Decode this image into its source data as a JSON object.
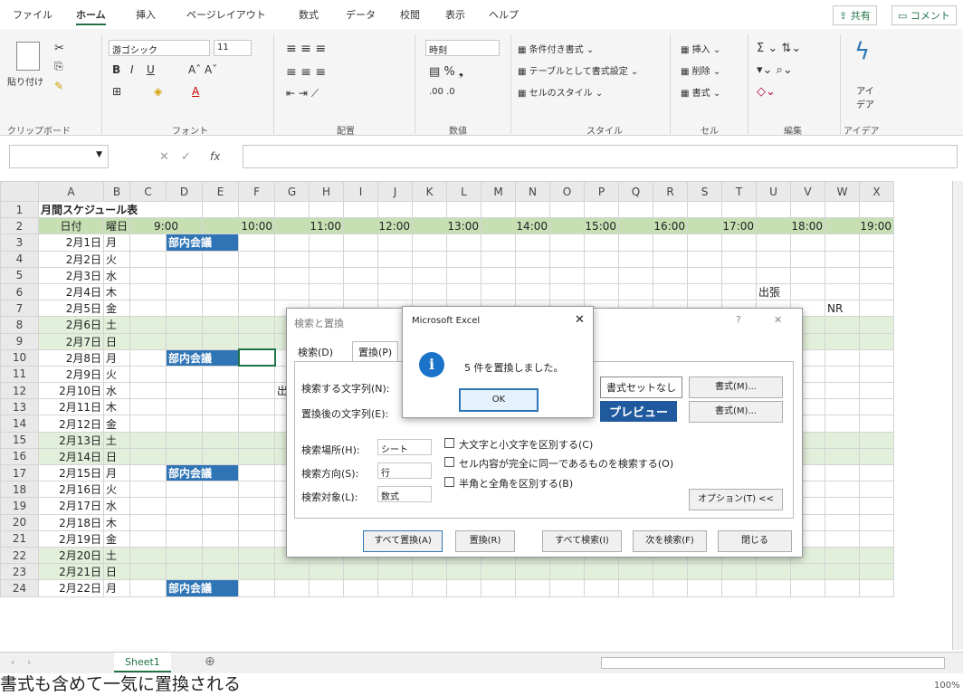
{
  "ribbon_tabs": [
    "ファイル",
    "ホーム",
    "挿入",
    "ページレイアウト",
    "数式",
    "データ",
    "校閲",
    "表示",
    "ヘルプ"
  ],
  "share": "共有",
  "comment": "コメント",
  "ribbon": {
    "paste": "貼り付け",
    "font_name": "游ゴシック",
    "font_size": "11",
    "number_format": "時刻",
    "cond_format": "条件付き書式",
    "table_format": "テーブルとして書式設定",
    "cell_style": "セルのスタイル",
    "insert": "挿入",
    "delete": "削除",
    "format": "書式",
    "ideas": "アイデア",
    "groups": [
      "クリップボード",
      "フォント",
      "配置",
      "数値",
      "スタイル",
      "セル",
      "編集",
      "アイデア"
    ]
  },
  "fx": "fx",
  "columns": [
    "A",
    "B",
    "C",
    "D",
    "E",
    "F",
    "G",
    "H",
    "I",
    "J",
    "K",
    "L",
    "M",
    "N",
    "O",
    "P",
    "Q",
    "R",
    "S",
    "T",
    "U",
    "V",
    "W",
    "X"
  ],
  "title": "月間スケジュール表",
  "header": {
    "date": "日付",
    "day": "曜日",
    "times": [
      "9:00",
      "10:00",
      "11:00",
      "12:00",
      "13:00",
      "14:00",
      "15:00",
      "16:00",
      "17:00",
      "18:00",
      "19:00"
    ]
  },
  "rows": [
    {
      "d": "2月1日",
      "w": "月",
      "m": "部内会議"
    },
    {
      "d": "2月2日",
      "w": "火"
    },
    {
      "d": "2月3日",
      "w": "水"
    },
    {
      "d": "2月4日",
      "w": "木",
      "trip": "出張"
    },
    {
      "d": "2月5日",
      "w": "金",
      "nr": "NR"
    },
    {
      "d": "2月6日",
      "w": "土"
    },
    {
      "d": "2月7日",
      "w": "日"
    },
    {
      "d": "2月8日",
      "w": "月",
      "m": "部内会議"
    },
    {
      "d": "2月9日",
      "w": "火"
    },
    {
      "d": "2月10日",
      "w": "水",
      "trip2": "出張"
    },
    {
      "d": "2月11日",
      "w": "木"
    },
    {
      "d": "2月12日",
      "w": "金"
    },
    {
      "d": "2月13日",
      "w": "土"
    },
    {
      "d": "2月14日",
      "w": "日"
    },
    {
      "d": "2月15日",
      "w": "月",
      "m": "部内会議"
    },
    {
      "d": "2月16日",
      "w": "火"
    },
    {
      "d": "2月17日",
      "w": "水"
    },
    {
      "d": "2月18日",
      "w": "木"
    },
    {
      "d": "2月19日",
      "w": "金"
    },
    {
      "d": "2月20日",
      "w": "土"
    },
    {
      "d": "2月21日",
      "w": "日"
    },
    {
      "d": "2月22日",
      "w": "月",
      "m": "部内会議"
    }
  ],
  "sheet_tab": "Sheet1",
  "zoom": "100%",
  "caption": "書式も含めて一気に置換される",
  "find_dialog": {
    "title": "検索と置換",
    "tab_find": "検索(D)",
    "tab_replace": "置換(P)",
    "find_what": "検索する文字列(N):",
    "replace_with": "置換後の文字列(E):",
    "no_format": "書式セットなし",
    "preview": "プレビュー",
    "format_btn": "書式(M)...",
    "within_label": "検索場所(H):",
    "within": "シート",
    "search_label": "検索方向(S):",
    "search": "行",
    "look_label": "検索対象(L):",
    "look": "数式",
    "match_case": "大文字と小文字を区別する(C)",
    "match_entire": "セル内容が完全に同一であるものを検索する(O)",
    "match_byte": "半角と全角を区別する(B)",
    "options": "オプション(T) <<",
    "replace_all": "すべて置換(A)",
    "replace": "置換(R)",
    "find_all": "すべて検索(I)",
    "find_next": "次を検索(F)",
    "close": "閉じる"
  },
  "msgbox": {
    "title": "Microsoft Excel",
    "message": "5 件を置換しました。",
    "ok": "OK"
  }
}
